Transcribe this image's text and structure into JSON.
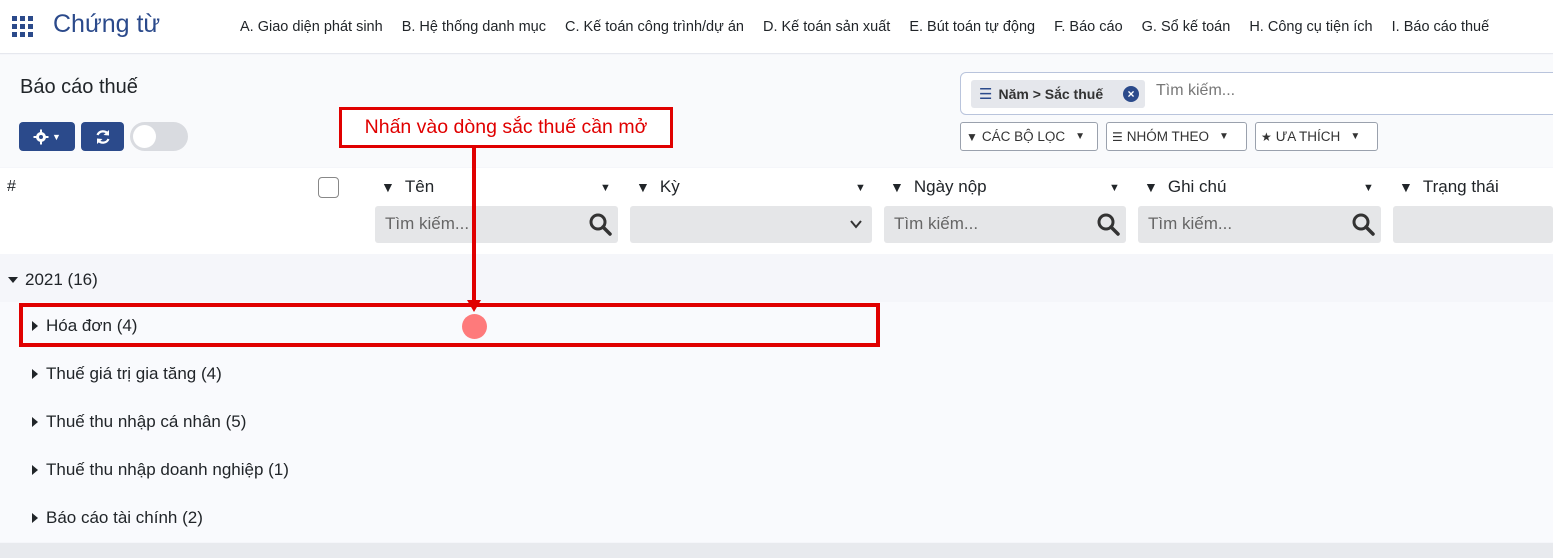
{
  "navbar": {
    "app_title": "Chứng từ",
    "menu": [
      "A. Giao diện phát sinh",
      "B. Hệ thống danh mục",
      "C. Kế toán công trình/dự án",
      "D. Kế toán sản xuất",
      "E. Bút toán tự động",
      "F. Báo cáo",
      "G. Sổ kế toán",
      "H. Công cụ tiện ích",
      "I. Báo cáo thuế"
    ]
  },
  "control_panel": {
    "breadcrumb": "Báo cáo thuế",
    "search": {
      "facet": "Năm > Sắc thuế",
      "placeholder": "Tìm kiếm..."
    },
    "filters_label": "CÁC BỘ LỌC",
    "group_by_label": "NHÓM THEO",
    "favorites_label": "ƯA THÍCH"
  },
  "table": {
    "hash_header": "#",
    "columns": [
      {
        "title": "Tên",
        "filter": "search",
        "placeholder": "Tìm kiếm..."
      },
      {
        "title": "Kỳ",
        "filter": "select",
        "placeholder": ""
      },
      {
        "title": "Ngày nộp",
        "filter": "search",
        "placeholder": "Tìm kiếm..."
      },
      {
        "title": "Ghi chú",
        "filter": "search",
        "placeholder": "Tìm kiếm..."
      },
      {
        "title": "Trạng thái",
        "filter": "search",
        "placeholder": ""
      }
    ]
  },
  "groups": {
    "year": "2021 (16)",
    "rows": [
      "Hóa đơn (4)",
      "Thuế giá trị gia tăng (4)",
      "Thuế thu nhập cá nhân (5)",
      "Thuế thu nhập doanh nghiệp (1)",
      "Báo cáo tài chính (2)"
    ]
  },
  "annotation": {
    "callout": "Nhấn vào dòng sắc thuế cần mở"
  },
  "colors": {
    "brand": "#2b4a8b",
    "annotation": "#e00000"
  }
}
